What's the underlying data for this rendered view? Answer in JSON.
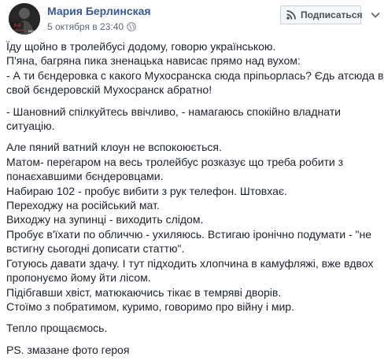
{
  "header": {
    "author": "Мария Берлинская",
    "timestamp": "5 октября в 23:40",
    "privacy_icon": "globe-icon",
    "follow_label": "Подписаться",
    "follow_icon": "rss-icon",
    "more_icon": "chevron-down-icon",
    "avatar_text_top": "8-9",
    "avatar_text_mid": "ВЕРЕСНЯ",
    "avatar_text_bottom": "BEAT"
  },
  "post": {
    "paragraphs": [
      [
        "Їду щойно в тролейбусі додому, говорю українською.",
        "П'яна, багряна пика зненацька нависає прямо над вухом:",
        "- А ти бєндеровка с какого Мухосранска сюда пріпьорлась? Єдь атсюда в свой бєндеровскій Мухосранск абратно!"
      ],
      [
        "- Шановний спілкуйтесь ввічливо, - намагаюсь спокійно владнати ситуацію."
      ],
      [
        "Але пяний ватний клоун не вспокоюється.",
        "Матом- перегаром на весь тролейбус розказує що треба робити з понаєхавшими бєндеровцами.",
        "Набираю 102 - пробує вибити з рук телефон. Штовхає.",
        "Переходжу на російський мат.",
        "Виходжу на зупинці - виходить слідом.",
        "Пробує в'їхати по обличчю - ухиляюсь. Встигаю іронічно подумати - \"не встигну сьогодні дописати статтю\".",
        "Готуюсь давати здачу. І тут підходить хлопчина в камуфляжі, вже вдвох пропонуємо йому йти лісом.",
        "Підібгавши хвіст, матюкаючись тікає в темряві дворів.",
        "Стоїмо з побратимом, куримо, говоримо про війну і мир."
      ],
      [
        "Тепло прощаємось."
      ],
      [
        "PS. змазане фото героя"
      ]
    ]
  }
}
